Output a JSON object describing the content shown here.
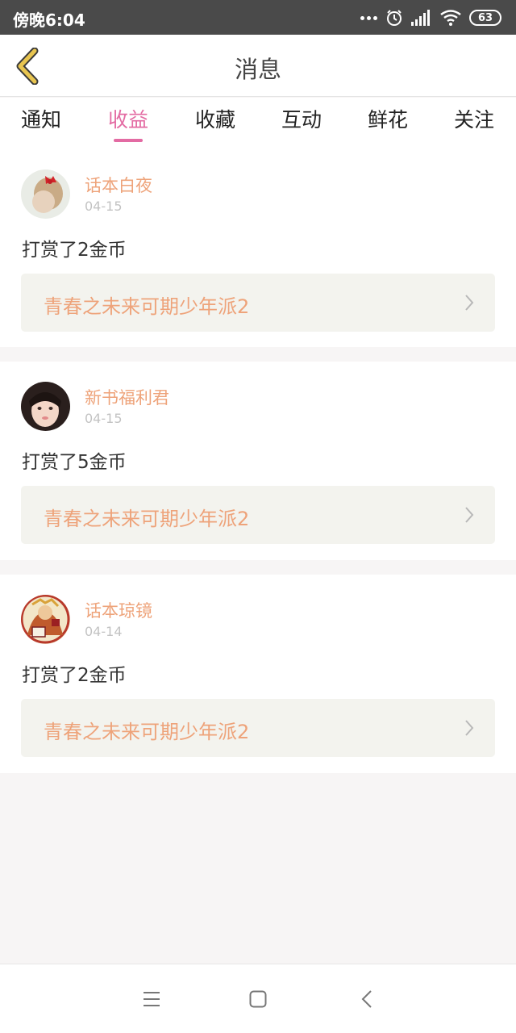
{
  "status_bar": {
    "time": "傍晚6:04",
    "battery": "63",
    "icons": [
      "more-dots-icon",
      "alarm-icon",
      "signal-icon",
      "wifi-icon",
      "battery-icon"
    ]
  },
  "header": {
    "title": "消息",
    "back_icon": "chevron-left-icon"
  },
  "tabs": [
    {
      "label": "通知",
      "active": false
    },
    {
      "label": "收益",
      "active": true
    },
    {
      "label": "收藏",
      "active": false
    },
    {
      "label": "互动",
      "active": false
    },
    {
      "label": "鲜花",
      "active": false
    },
    {
      "label": "关注",
      "active": false
    }
  ],
  "messages": [
    {
      "username": "话本白夜",
      "date": "04-15",
      "action": "打赏了2金币",
      "book_title": "青春之未来可期少年派2"
    },
    {
      "username": "新书福利君",
      "date": "04-15",
      "action": "打赏了5金币",
      "book_title": "青春之未来可期少年派2"
    },
    {
      "username": "话本琼镜",
      "date": "04-14",
      "action": "打赏了2金币",
      "book_title": "青春之未来可期少年派2"
    }
  ],
  "nav_bar": {
    "icons": [
      "menu-icon",
      "home-square-icon",
      "back-arrow-icon"
    ]
  },
  "colors": {
    "accent_pink": "#e36ba3",
    "name_orange": "#eea37a",
    "back_yellow": "#e8c550",
    "status_bar": "#4a4a4a"
  }
}
